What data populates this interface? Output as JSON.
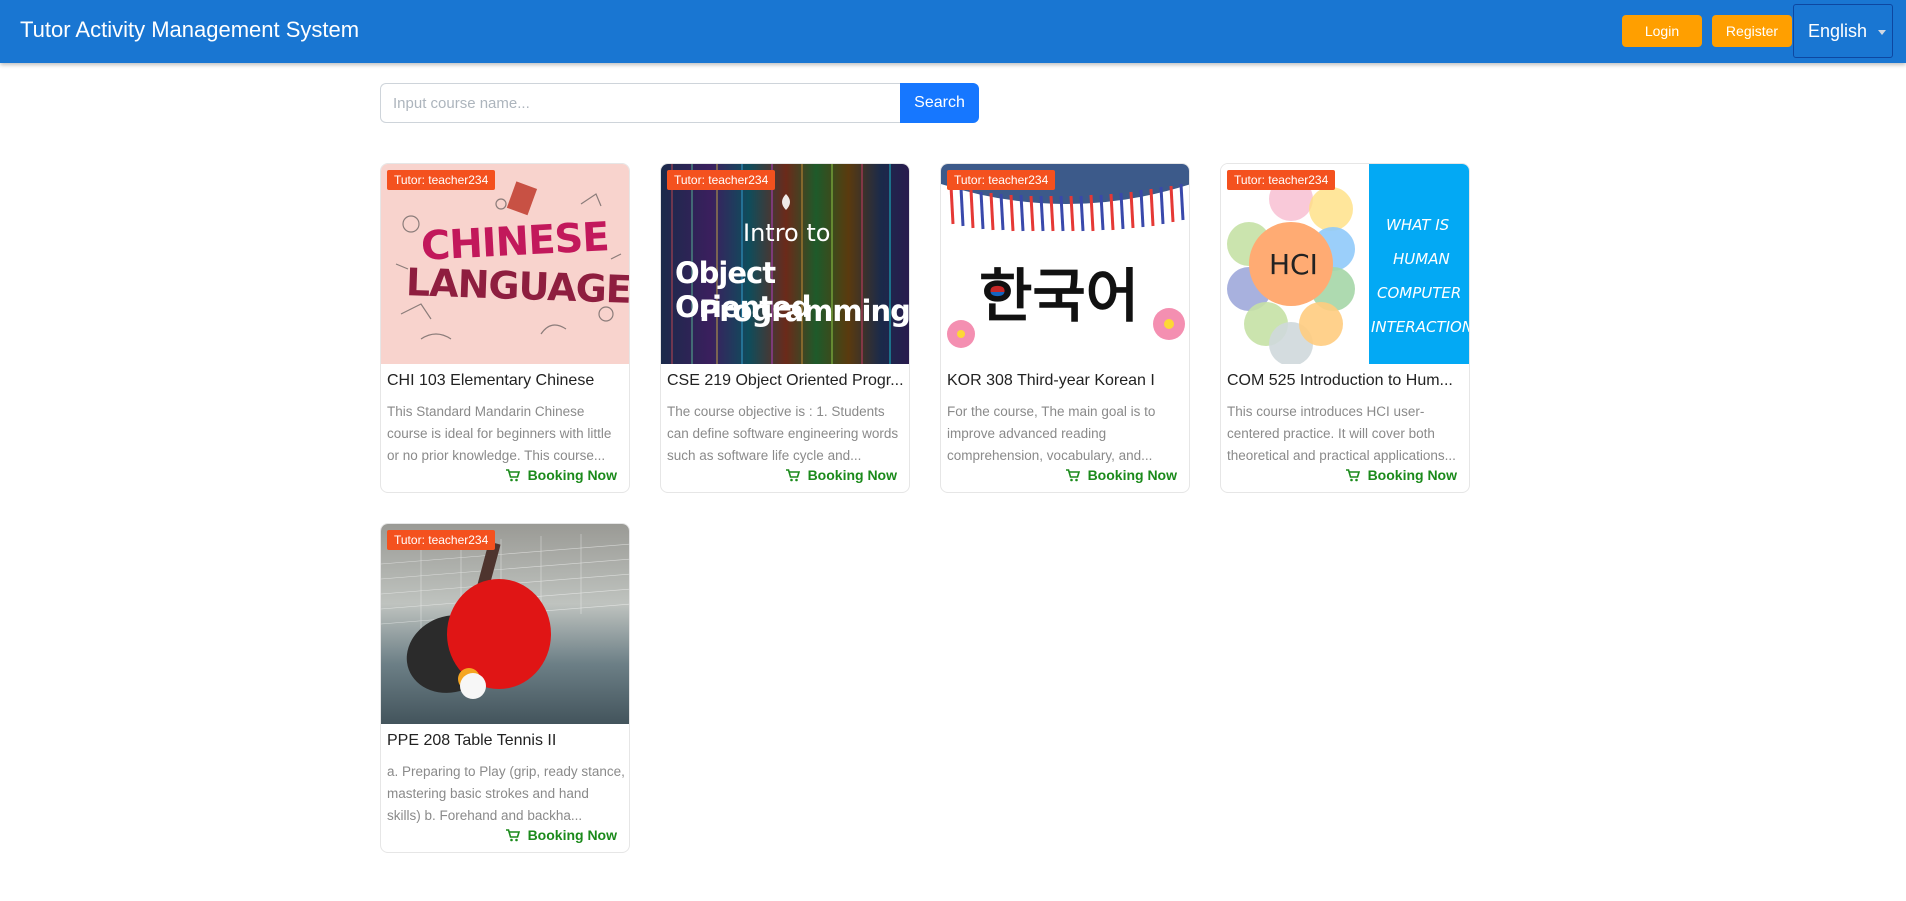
{
  "header": {
    "title": "Tutor Activity Management System",
    "login_label": "Login",
    "register_label": "Register",
    "language": "English"
  },
  "search": {
    "placeholder": "Input course name...",
    "button_label": "Search"
  },
  "courses": [
    {
      "tutor": "Tutor: teacher234",
      "title": "CHI 103 Elementary Chinese",
      "description": "This Standard Mandarin Chinese course is ideal for beginners with little or no prior knowledge. This course...",
      "booking": "Booking Now",
      "image_text": [
        "CHINESE",
        "LANGUAGE"
      ]
    },
    {
      "tutor": "Tutor: teacher234",
      "title": "CSE 219 Object Oriented Progr...",
      "description": "The course objective is : 1. Students can define software engineering words such as software life cycle and...",
      "booking": "Booking Now",
      "image_text": [
        "Intro to",
        "Object Oriented",
        "Programming"
      ]
    },
    {
      "tutor": "Tutor: teacher234",
      "title": "KOR 308 Third-year Korean I",
      "description": "For the course, The main goal is to improve advanced reading comprehension, vocabulary, and...",
      "booking": "Booking Now",
      "image_text": [
        "한국어"
      ]
    },
    {
      "tutor": "Tutor: teacher234",
      "title": "COM 525 Introduction to Hum...",
      "description": "This course introduces HCI user-centered practice. It will cover both theoretical and practical applications...",
      "booking": "Booking Now",
      "image_text": [
        "HCI",
        "WHAT IS",
        "HUMAN",
        "COMPUTER",
        "INTERACTION"
      ]
    },
    {
      "tutor": "Tutor: teacher234",
      "title": "PPE 208 Table Tennis II",
      "description": "a. Preparing to Play (grip, ready stance, mastering basic strokes and hand skills) b. Forehand and backha...",
      "booking": "Booking Now",
      "image_text": []
    }
  ],
  "colors": {
    "header_bg": "#1976d2",
    "button_orange": "#ff9f00",
    "badge": "#f4511e",
    "booking_green": "#1b8a1b",
    "search_blue": "#1677ff"
  },
  "icons": [
    "cart-icon",
    "chevron-down-icon"
  ]
}
